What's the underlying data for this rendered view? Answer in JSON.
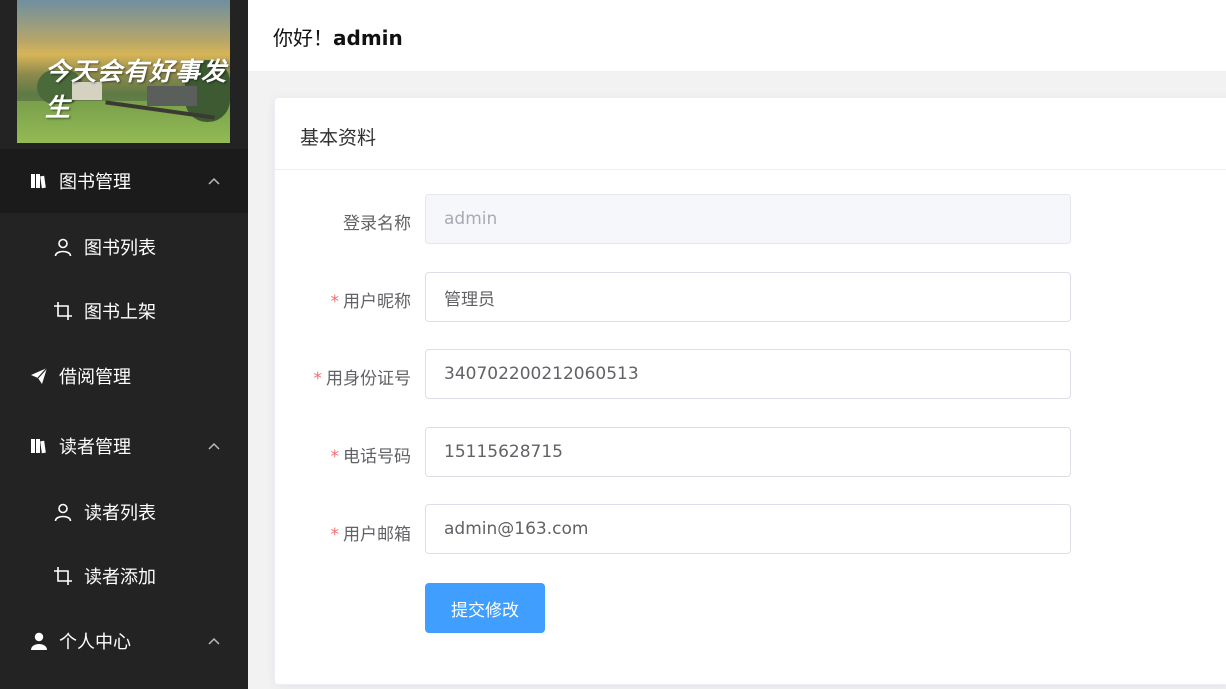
{
  "logo": {
    "text": "今天会有好事发生"
  },
  "header": {
    "greeting_prefix": "你好！",
    "username": "admin"
  },
  "sidebar": {
    "items": [
      {
        "label": "图书管理",
        "icon": "bookshelf-icon",
        "expanded": true
      },
      {
        "label": "图书列表",
        "icon": "user-icon"
      },
      {
        "label": "图书上架",
        "icon": "crop-icon"
      },
      {
        "label": "借阅管理",
        "icon": "paper-plane-icon"
      },
      {
        "label": "读者管理",
        "icon": "bookshelf-icon",
        "expanded": true
      },
      {
        "label": "读者列表",
        "icon": "user-icon"
      },
      {
        "label": "读者添加",
        "icon": "crop-icon"
      },
      {
        "label": "个人中心",
        "icon": "user-solid-icon",
        "expanded": true
      }
    ]
  },
  "card": {
    "title": "基本资料",
    "fields": [
      {
        "label": "登录名称",
        "required": false,
        "value": "admin",
        "disabled": true
      },
      {
        "label": "用户昵称",
        "required": true,
        "value": "管理员",
        "disabled": false
      },
      {
        "label": "用身份证号",
        "required": true,
        "value": "340702200212060513",
        "disabled": false
      },
      {
        "label": "电话号码",
        "required": true,
        "value": "15115628715",
        "disabled": false
      },
      {
        "label": "用户邮箱",
        "required": true,
        "value": "admin@163.com",
        "disabled": false
      }
    ],
    "required_mark": "*",
    "submit_label": "提交修改"
  },
  "colors": {
    "sidebar_bg": "#232323",
    "primary": "#409eff",
    "required": "#f56c6c"
  }
}
